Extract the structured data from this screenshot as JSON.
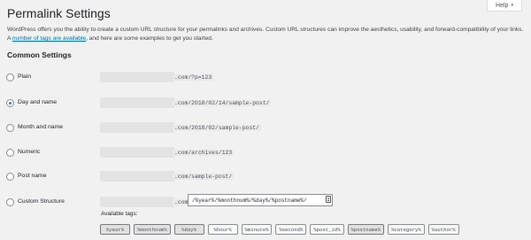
{
  "help": {
    "label": "Help",
    "caret": "▾"
  },
  "page_title": "Permalink Settings",
  "intro": {
    "line1": "WordPress offers you the ability to create a custom URL structure for your permalinks and archives. Custom URL structures can improve the aesthetics, usability, and forward-compatibility of your links.",
    "line2_prefix": "A ",
    "link": "number of tags are available",
    "line2_suffix": ", and here are some examples to get you started."
  },
  "section_title": "Common Settings",
  "options": [
    {
      "label": "Plain",
      "suffix": ".com/?p=123",
      "checked": false
    },
    {
      "label": "Day and name",
      "suffix": ".com/2018/02/14/sample-post/",
      "checked": true
    },
    {
      "label": "Month and name",
      "suffix": ".com/2018/02/sample-post/",
      "checked": false
    },
    {
      "label": "Numeric",
      "suffix": ".com/archives/123",
      "checked": false
    },
    {
      "label": "Post name",
      "suffix": ".com/sample-post/",
      "checked": false
    },
    {
      "label": "Custom Structure",
      "suffix": ".com",
      "checked": false
    }
  ],
  "custom_structure_value": "/%year%/%monthnum%/%day%/%postname%/",
  "available_tags_label": "Available tags:",
  "tags": [
    "%year%",
    "%monthnum%",
    "%day%",
    "%hour%",
    "%minute%",
    "%second%",
    "%post_id%",
    "%postname%",
    "%category%",
    "%author%"
  ],
  "active_tags": [
    "%year%",
    "%monthnum%",
    "%day%",
    "%postname%"
  ]
}
